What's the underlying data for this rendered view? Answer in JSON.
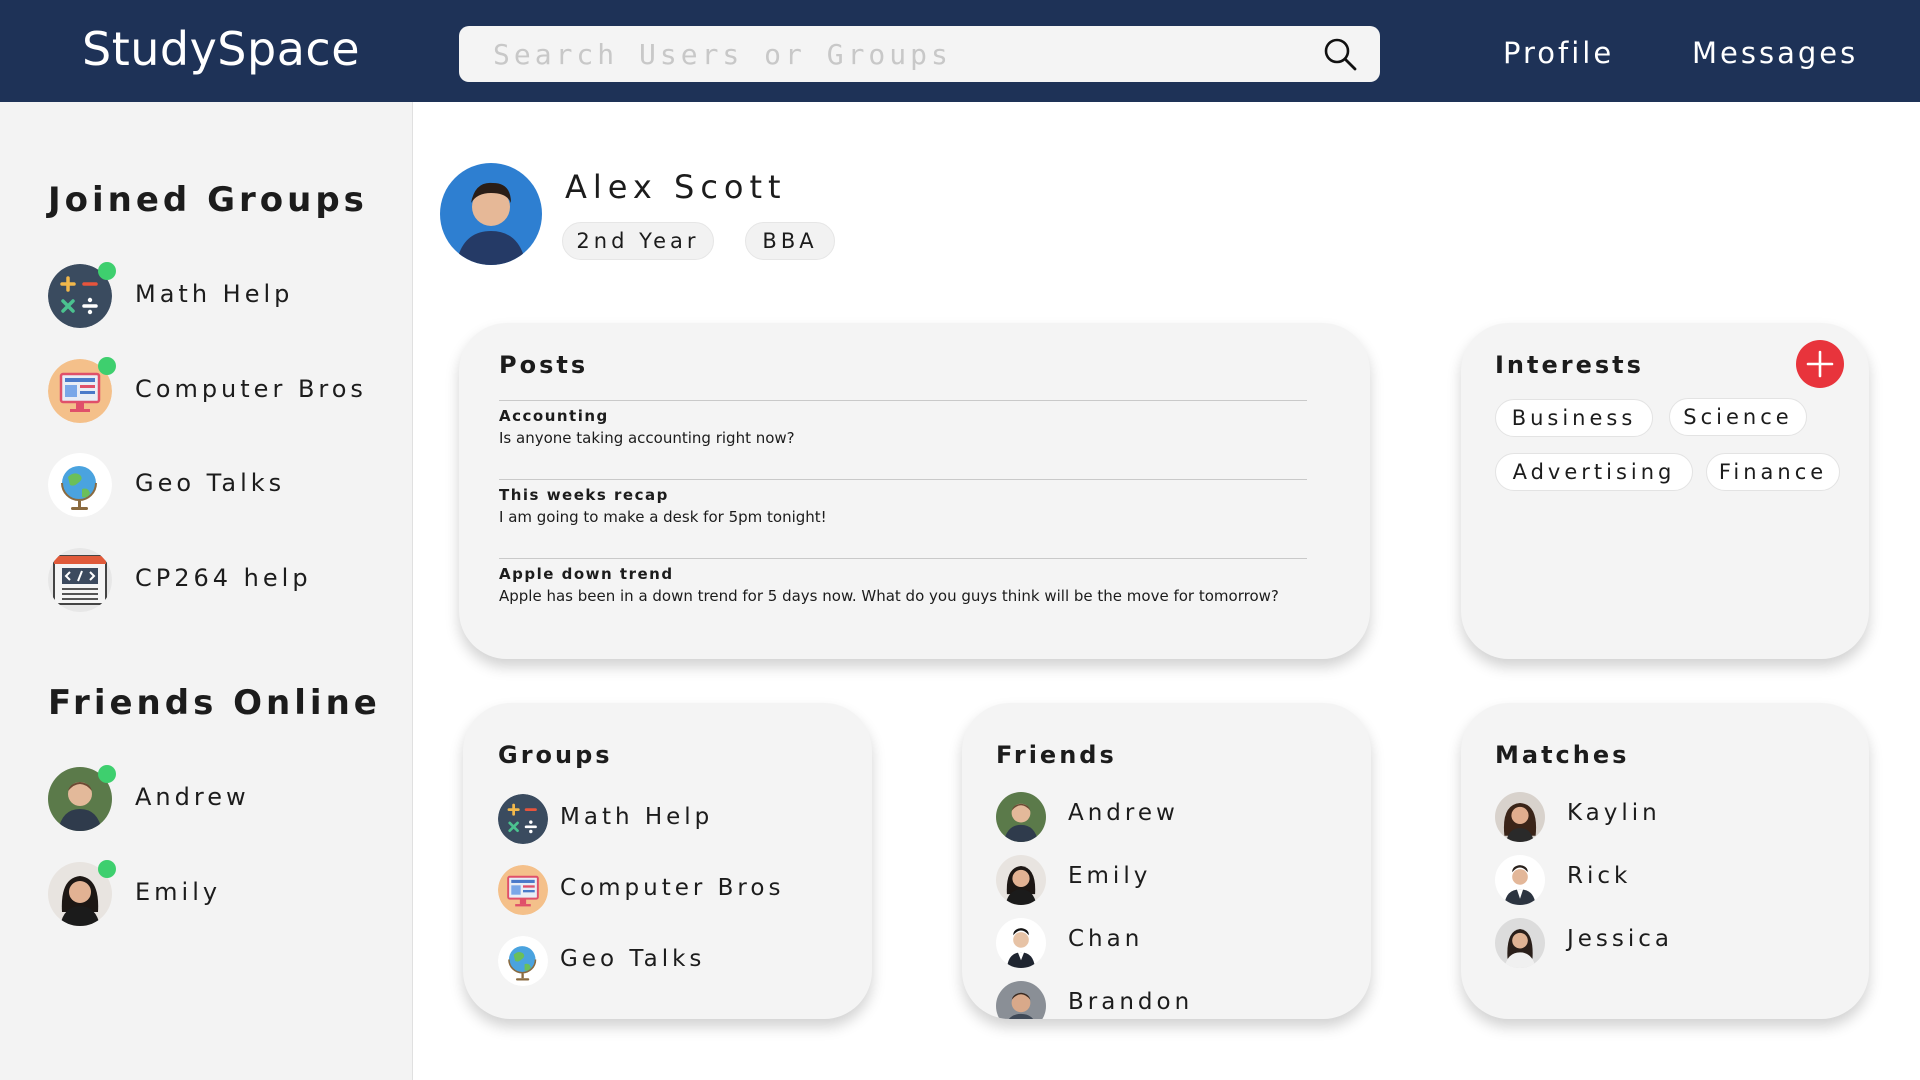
{
  "header": {
    "brand": "StudySpace",
    "search_placeholder": "Search Users or Groups",
    "search_icon": "search-icon",
    "nav": {
      "profile": "Profile",
      "messages": "Messages"
    }
  },
  "sidebar": {
    "joined_heading": "Joined Groups",
    "groups": [
      {
        "label": "Math Help",
        "icon": "math-symbols-icon",
        "online": true
      },
      {
        "label": "Computer Bros",
        "icon": "computer-icon",
        "online": true
      },
      {
        "label": "Geo Talks",
        "icon": "globe-icon",
        "online": false
      },
      {
        "label": "CP264 help",
        "icon": "code-window-icon",
        "online": false
      }
    ],
    "friends_heading": "Friends Online",
    "friends": [
      {
        "label": "Andrew",
        "online": true
      },
      {
        "label": "Emily",
        "online": true
      }
    ]
  },
  "profile": {
    "name": "Alex Scott",
    "tags": [
      "2nd Year",
      "BBA"
    ]
  },
  "posts": {
    "title": "Posts",
    "items": [
      {
        "title": "Accounting",
        "body": "Is anyone taking accounting right now?"
      },
      {
        "title": "This weeks recap",
        "body": "I am going to make a desk for 5pm tonight!"
      },
      {
        "title": "Apple down trend",
        "body": "Apple has been in a down trend for 5 days now. What do you guys think will be the move for tomorrow?"
      }
    ]
  },
  "interests": {
    "title": "Interests",
    "add_icon": "plus-icon",
    "items": [
      "Business",
      "Science",
      "Advertising",
      "Finance"
    ]
  },
  "groups_card": {
    "title": "Groups",
    "items": [
      "Math Help",
      "Computer Bros",
      "Geo Talks"
    ]
  },
  "friends_card": {
    "title": "Friends",
    "items": [
      "Andrew",
      "Emily",
      "Chan",
      "Brandon"
    ]
  },
  "matches_card": {
    "title": "Matches",
    "items": [
      "Kaylin",
      "Rick",
      "Jessica"
    ]
  },
  "colors": {
    "header_bg": "#1e3257",
    "online": "#3ecf6e",
    "add_button": "#e8343c",
    "sidebar_bg": "#f3f3f3",
    "card_bg": "#f4f4f4"
  }
}
